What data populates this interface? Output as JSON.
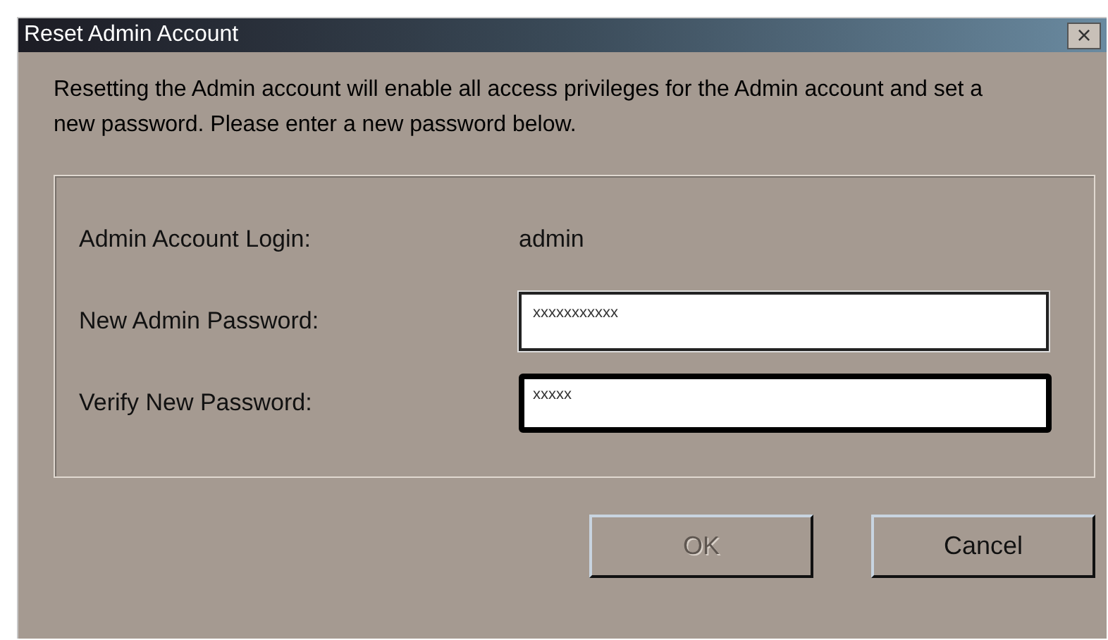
{
  "window": {
    "title": "Reset Admin Account",
    "close": "×"
  },
  "message": "Resetting the Admin account will enable all access privileges for the Admin account and set a new password. Please enter a new password below.",
  "fields": [
    {
      "kind": "static",
      "label": "Admin Account Login:",
      "value": "admin"
    },
    {
      "kind": "input",
      "label": "New Admin Password:",
      "value": "xxxxxxxxxxx",
      "focused": false
    },
    {
      "kind": "input",
      "label": "Verify New Password:",
      "value": "xxxxx",
      "focused": true
    }
  ],
  "buttons": [
    {
      "label": "OK",
      "disabled": true
    },
    {
      "label": "Cancel",
      "disabled": false
    }
  ]
}
